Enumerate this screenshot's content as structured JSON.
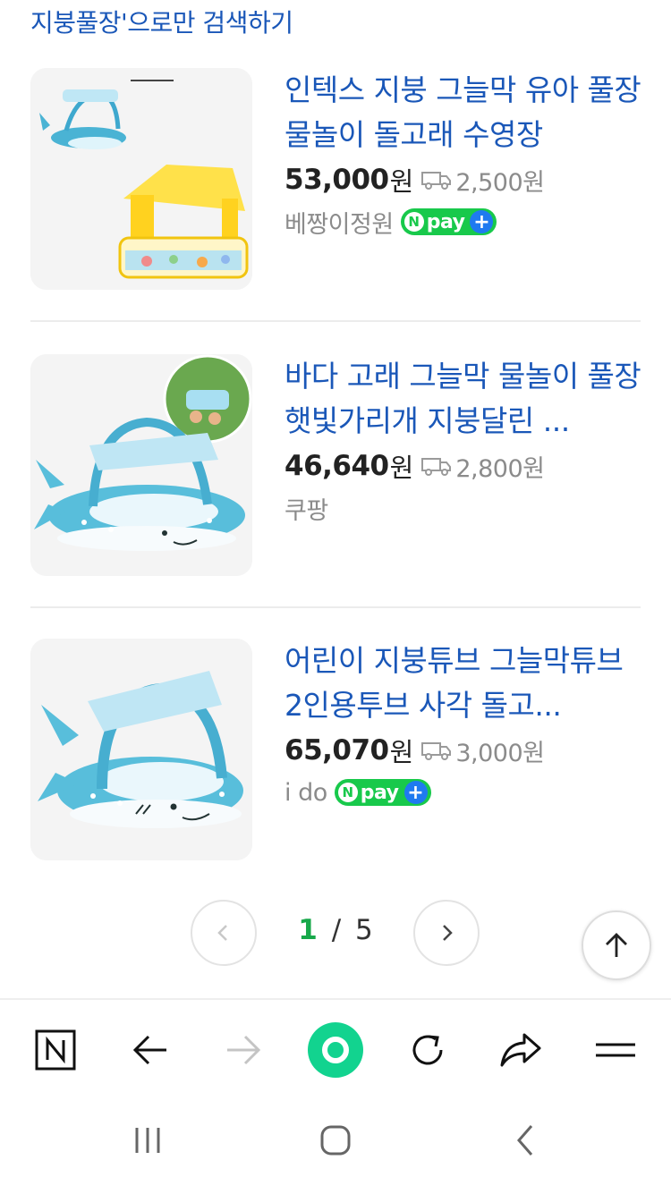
{
  "search_only_link": "지붕풀장'으로만 검색하기",
  "products": [
    {
      "title": "인텍스 지붕 그늘막 유아 풀장 물놀이 돌고래 수영장",
      "price": "53,000",
      "currency": "원",
      "shipping_fee": "2,500원",
      "seller": "베짱이정원",
      "npay": true
    },
    {
      "title": "바다 고래 그늘막 물놀이 풀장 햇빛가리개 지붕달린 ...",
      "price": "46,640",
      "currency": "원",
      "shipping_fee": "2,800원",
      "seller": "쿠팡",
      "npay": false
    },
    {
      "title": "어린이 지붕튜브 그늘막튜브 2인용투브 사각 돌고...",
      "price": "65,070",
      "currency": "원",
      "shipping_fee": "3,000원",
      "seller": "i do",
      "npay": true
    }
  ],
  "npay_badge": {
    "n": "N",
    "pay": "pay",
    "plus": "+"
  },
  "pagination": {
    "current": "1",
    "separator": "/",
    "total": "5"
  },
  "colors": {
    "title_blue": "#1a57b8",
    "naver_green": "#18c94b",
    "npay_plus_blue": "#1f7af0",
    "page_current": "#17a84a"
  },
  "toolbar_icons": [
    "naver-home-icon",
    "back-arrow-icon",
    "forward-arrow-icon",
    "green-dot-icon",
    "refresh-icon",
    "share-icon",
    "menu-icon"
  ],
  "system_nav_icons": [
    "recent-apps-icon",
    "home-icon",
    "back-icon"
  ]
}
